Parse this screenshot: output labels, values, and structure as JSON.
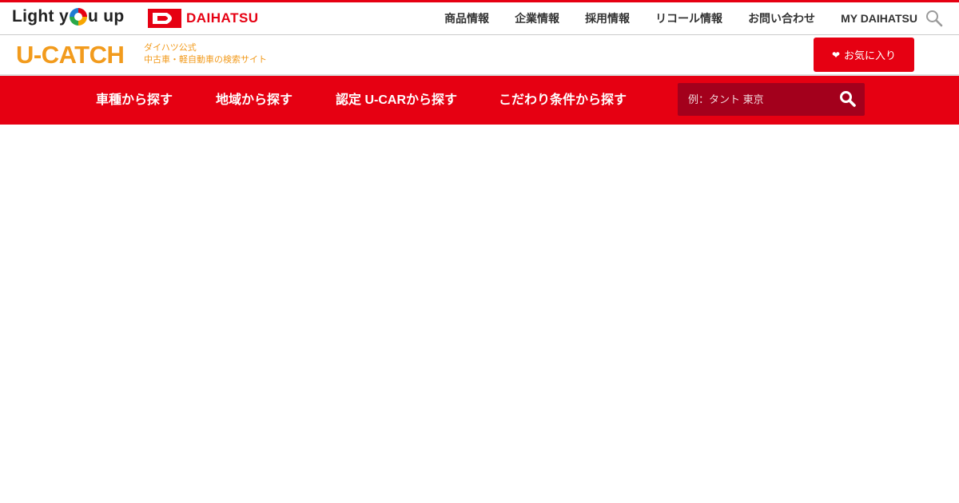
{
  "header": {
    "logo_text_before": "Light y",
    "logo_text_after": "u up",
    "brand_name": "DAIHATSU",
    "nav": [
      {
        "label": "商品情報"
      },
      {
        "label": "企業情報"
      },
      {
        "label": "採用情報"
      },
      {
        "label": "リコール情報"
      },
      {
        "label": "お問い合わせ"
      },
      {
        "label": "MY DAIHATSU"
      }
    ],
    "search_icon": "search-icon"
  },
  "subheader": {
    "logo": "U-CATCH",
    "tagline_line1": "ダイハツ公式",
    "tagline_line2": "中古車・軽自動車の検索サイト",
    "favorites_label": "お気に入り",
    "favorites_icon": "heart-icon"
  },
  "main_nav": {
    "items": [
      {
        "label": "車種から探す"
      },
      {
        "label": "地域から探す"
      },
      {
        "label": "認定 U-CARから探す"
      },
      {
        "label": "こだわり条件から探す"
      }
    ],
    "search_placeholder": "例：タント 東京",
    "search_icon": "search-icon"
  },
  "colors": {
    "brand_red": "#e60012",
    "search_bg": "#a3001c",
    "ucatch_orange": "#f29b1d"
  }
}
